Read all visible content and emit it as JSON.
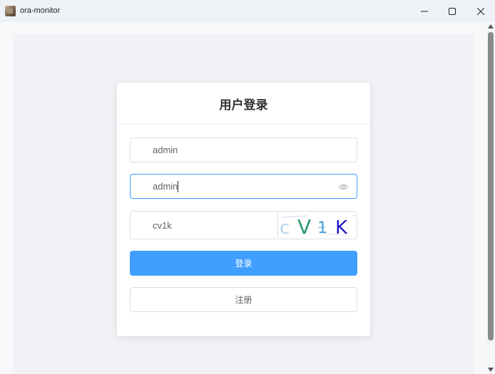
{
  "window": {
    "title": "ora-monitor"
  },
  "icons": {
    "app": "app-icon",
    "minimize": "minimize-icon",
    "maximize": "maximize-icon",
    "close": "close-icon",
    "password_toggle": "eye-icon"
  },
  "login": {
    "title": "用户登录",
    "username_value": "admin",
    "password_value": "admin",
    "captcha_value": "cv1k",
    "captcha_image_text": [
      "c",
      "V",
      "1",
      "K"
    ],
    "login_label": "登录",
    "register_label": "注册"
  },
  "colors": {
    "primary": "#409eff",
    "border": "#dcdfe6",
    "text": "#606266",
    "title": "#303133"
  }
}
